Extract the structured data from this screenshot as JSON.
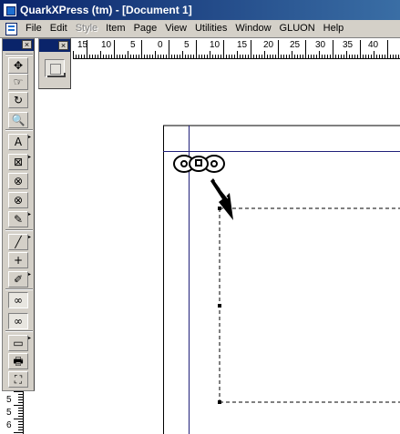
{
  "window": {
    "title": "QuarkXPress (tm) - [Document 1]",
    "app_icon": "quarkxpress-app-icon"
  },
  "menubar": {
    "doc_icon": "document-icon",
    "items": [
      {
        "label": "File",
        "enabled": true
      },
      {
        "label": "Edit",
        "enabled": true
      },
      {
        "label": "Style",
        "enabled": false
      },
      {
        "label": "Item",
        "enabled": true
      },
      {
        "label": "Page",
        "enabled": true
      },
      {
        "label": "View",
        "enabled": true
      },
      {
        "label": "Utilities",
        "enabled": true
      },
      {
        "label": "Window",
        "enabled": true
      },
      {
        "label": "GLUON",
        "enabled": true
      },
      {
        "label": "Help",
        "enabled": true
      }
    ]
  },
  "tool_palette": {
    "close_label": "×",
    "tools": [
      {
        "name": "item-tool",
        "glyph": "✥"
      },
      {
        "name": "content-tool",
        "glyph": "☞"
      },
      {
        "name": "rotation-tool",
        "glyph": "↻"
      },
      {
        "name": "zoom-tool",
        "glyph": "🔍"
      },
      {
        "name": "text-box-tool",
        "glyph": "A"
      },
      {
        "name": "rectangle-picture-box-tool",
        "glyph": "⊠"
      },
      {
        "name": "oval-picture-box-tool",
        "glyph": "⊗"
      },
      {
        "name": "circle-picture-box-tool",
        "glyph": "⊗"
      },
      {
        "name": "bezier-picture-box-tool",
        "glyph": "✎"
      },
      {
        "name": "line-tool",
        "glyph": "╱"
      },
      {
        "name": "orthogonal-line-tool",
        "glyph": "+"
      },
      {
        "name": "bezier-line-tool",
        "glyph": "✐"
      },
      {
        "name": "linking-tool",
        "glyph": "∞"
      },
      {
        "name": "unlinking-tool",
        "glyph": "∞"
      },
      {
        "name": "table-tool",
        "glyph": "▭"
      },
      {
        "name": "print-tool",
        "glyph": "🖶"
      },
      {
        "name": "fit-tool",
        "glyph": "⛶"
      }
    ]
  },
  "mini_palette": {
    "close_label": "×",
    "button_icon": "library-icon"
  },
  "ruler": {
    "horizontal_labels": [
      "15",
      "10",
      "5",
      "0",
      "5",
      "10",
      "15",
      "20",
      "25",
      "30",
      "35",
      "40"
    ],
    "vertical_labels": [
      "5",
      "5",
      "6"
    ]
  }
}
